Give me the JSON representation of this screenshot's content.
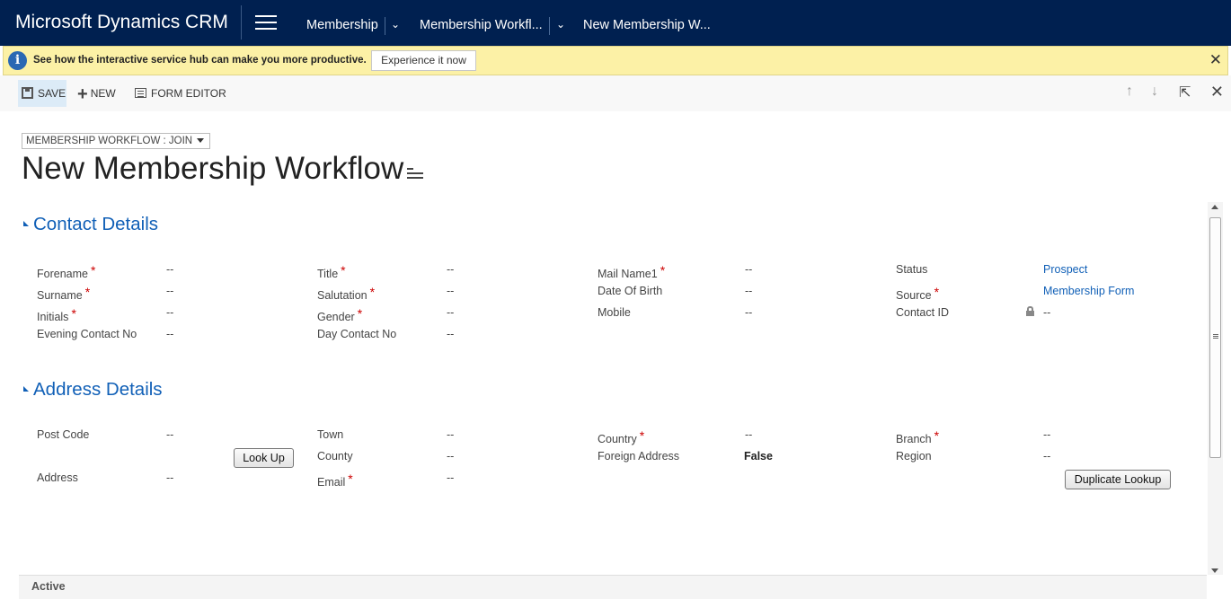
{
  "app": {
    "title": "Microsoft Dynamics CRM",
    "breadcrumbs": [
      "Membership",
      "Membership Workfl...",
      "New Membership W..."
    ]
  },
  "notification": {
    "text": "See how the interactive service hub can make you more productive.",
    "button": "Experience it now",
    "info_glyph": "i",
    "close_glyph": "✕"
  },
  "commands": {
    "save": "SAVE",
    "new": "NEW",
    "form_editor": "FORM EDITOR",
    "up_glyph": "↑",
    "down_glyph": "↓",
    "popout_glyph": "⇱",
    "close_glyph": "✕"
  },
  "header": {
    "form_selector": "MEMBERSHIP WORKFLOW : JOIN",
    "title": "New Membership Workflow"
  },
  "contact_details": {
    "heading": "Contact Details",
    "fields": {
      "forename": {
        "label": "Forename",
        "value": "--",
        "required": "*"
      },
      "surname": {
        "label": "Surname",
        "value": "--",
        "required": "*"
      },
      "initials": {
        "label": "Initials",
        "value": "--",
        "required": "*"
      },
      "evening_contact": {
        "label": "Evening Contact No",
        "value": "--"
      },
      "title": {
        "label": "Title",
        "value": "--",
        "required": "*"
      },
      "salutation": {
        "label": "Salutation",
        "value": "--",
        "required": "*"
      },
      "gender": {
        "label": "Gender",
        "value": "--",
        "required": "*"
      },
      "day_contact": {
        "label": "Day Contact No",
        "value": "--"
      },
      "mail_name": {
        "label": "Mail Name1",
        "value": "--",
        "required": "*"
      },
      "dob": {
        "label": "Date Of Birth",
        "value": "--"
      },
      "mobile": {
        "label": "Mobile",
        "value": "--"
      },
      "status": {
        "label": "Status",
        "value": "Prospect"
      },
      "source": {
        "label": "Source",
        "value": "Membership Form",
        "required": "*"
      },
      "contact_id": {
        "label": "Contact ID",
        "value": "--"
      }
    }
  },
  "address_details": {
    "heading": "Address Details",
    "lookup_button": "Look Up",
    "duplicate_button": "Duplicate Lookup",
    "fields": {
      "post_code": {
        "label": "Post Code",
        "value": "--"
      },
      "address": {
        "label": "Address",
        "value": "--"
      },
      "town": {
        "label": "Town",
        "value": "--"
      },
      "county": {
        "label": "County",
        "value": "--"
      },
      "email": {
        "label": "Email",
        "value": "--",
        "required": "*"
      },
      "country": {
        "label": "Country",
        "value": "--",
        "required": "*"
      },
      "foreign_address": {
        "label": "Foreign Address",
        "value": "False"
      },
      "branch": {
        "label": "Branch",
        "value": "--",
        "required": "*"
      },
      "region": {
        "label": "Region",
        "value": "--"
      }
    }
  },
  "footer": {
    "status": "Active"
  },
  "colors": {
    "nav_bg": "#002050",
    "accent": "#1160b7",
    "notify_bg": "#fcf1a6",
    "required": "#cc0000"
  }
}
